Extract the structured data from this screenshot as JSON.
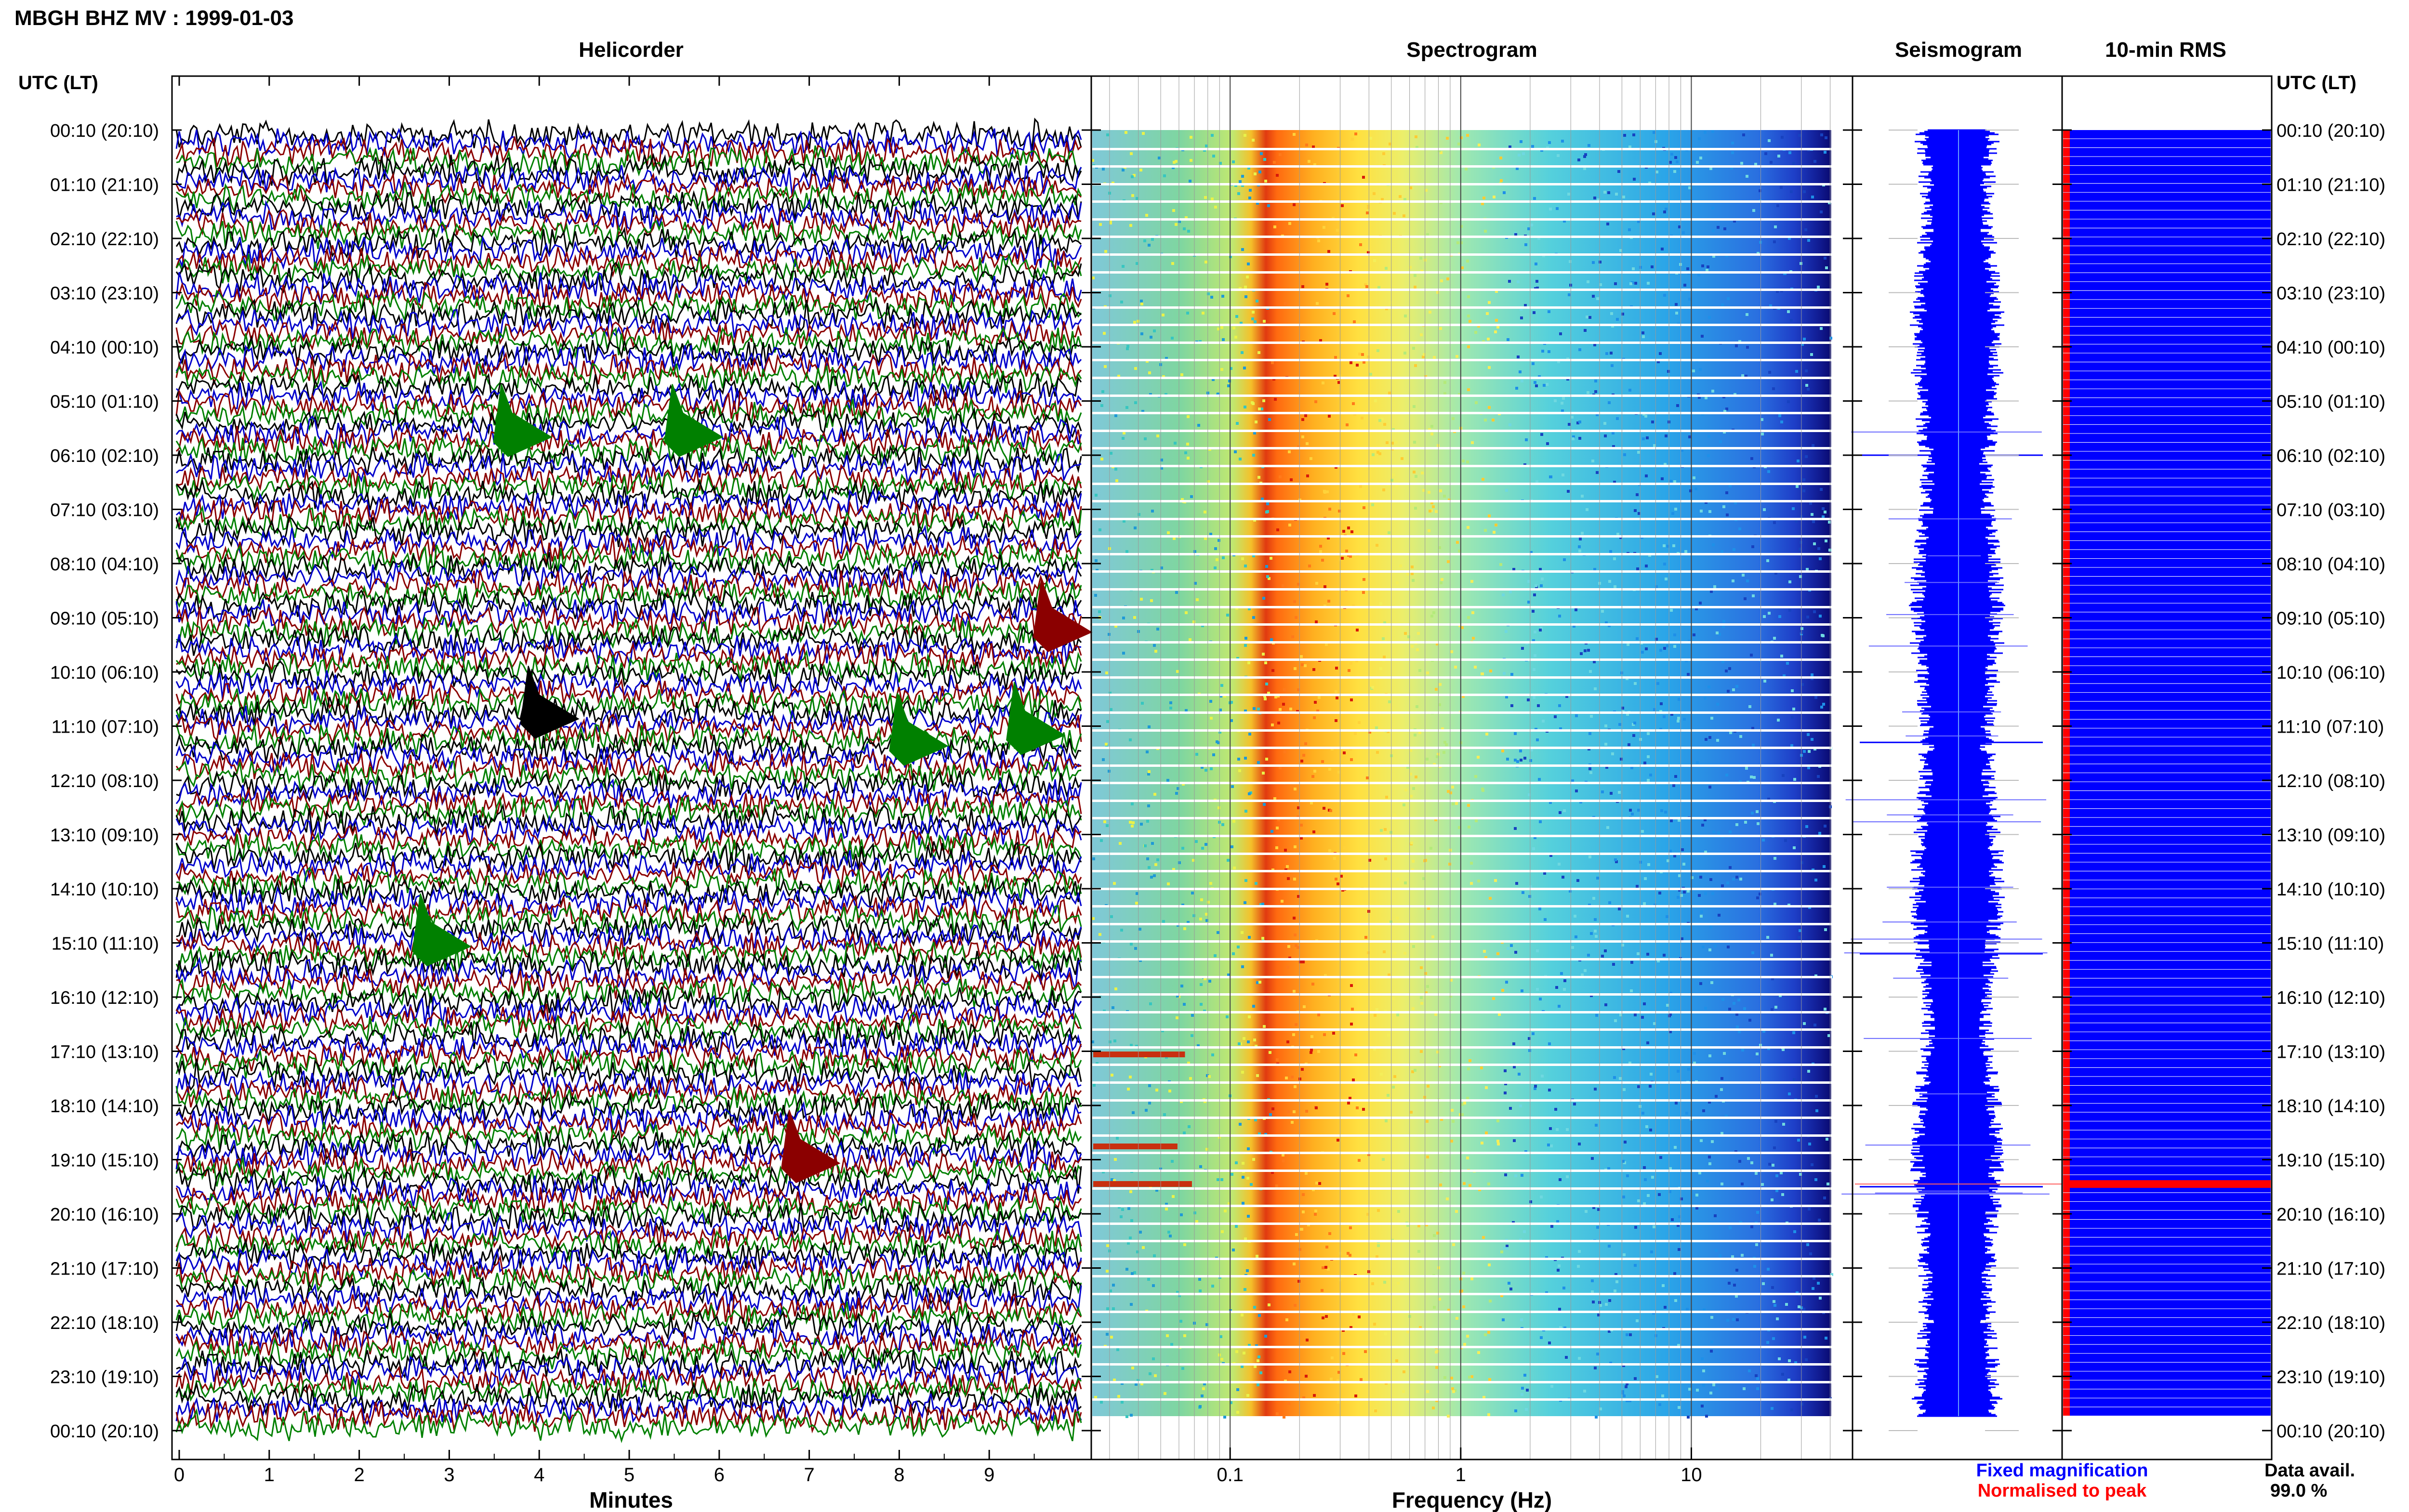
{
  "title": "MBGH BHZ MV : 1999-01-03",
  "panels": {
    "helicorder": "Helicorder",
    "spectrogram": "Spectrogram",
    "seismogram": "Seismogram",
    "rms": "10-min RMS"
  },
  "time_axis_label": "UTC (LT)",
  "hour_labels": [
    "00:10 (20:10)",
    "01:10 (21:10)",
    "02:10 (22:10)",
    "03:10 (23:10)",
    "04:10 (00:10)",
    "05:10 (01:10)",
    "06:10 (02:10)",
    "07:10 (03:10)",
    "08:10 (04:10)",
    "09:10 (05:10)",
    "10:10 (06:10)",
    "11:10 (07:10)",
    "12:10 (08:10)",
    "13:10 (09:10)",
    "14:10 (10:10)",
    "15:10 (11:10)",
    "16:10 (12:10)",
    "17:10 (13:10)",
    "18:10 (14:10)",
    "19:10 (15:10)",
    "20:10 (16:10)",
    "21:10 (17:10)",
    "22:10 (18:10)",
    "23:10 (19:10)",
    "00:10 (20:10)"
  ],
  "x_axes": {
    "helicorder": {
      "label": "Minutes",
      "ticks": [
        "0",
        "1",
        "2",
        "3",
        "4",
        "5",
        "6",
        "7",
        "8",
        "9"
      ],
      "range": [
        0,
        10
      ]
    },
    "spectrogram": {
      "label": "Frequency (Hz)",
      "ticks": [
        "0.1",
        "1",
        "10"
      ],
      "scale": "log",
      "range": [
        0.025,
        50
      ]
    }
  },
  "legend": {
    "fixed": "Fixed magnification",
    "normalised": "Normalised to peak",
    "data_avail_label": "Data avail.",
    "data_avail_value": "99.0 %"
  },
  "colors": {
    "trace_cycle": [
      "#000000",
      "#0000cc",
      "#8b0000",
      "#008000"
    ],
    "seismogram": "#0000ff",
    "rms_fixed": "#0000ff",
    "rms_peak": "#ff0000"
  },
  "chart_data": [
    {
      "type": "helicorder",
      "title": "Helicorder",
      "xlabel": "Minutes",
      "ylabel": "UTC (LT)",
      "xlim": [
        0,
        10
      ],
      "rows": 144,
      "events": [
        {
          "hour": 5.4,
          "minute": 3.6,
          "color": "#008000"
        },
        {
          "hour": 5.4,
          "minute": 5.5,
          "color": "#008000"
        },
        {
          "hour": 9.0,
          "minute": 9.6,
          "color": "#8b0000"
        },
        {
          "hour": 10.6,
          "minute": 3.9,
          "color": "#000000"
        },
        {
          "hour": 10.9,
          "minute": 9.3,
          "color": "#008000"
        },
        {
          "hour": 11.1,
          "minute": 8.0,
          "color": "#008000"
        },
        {
          "hour": 14.8,
          "minute": 2.7,
          "color": "#008000"
        },
        {
          "hour": 18.8,
          "minute": 6.8,
          "color": "#8b0000"
        }
      ]
    },
    {
      "type": "heatmap",
      "title": "Spectrogram",
      "xlabel": "Frequency (Hz)",
      "x_scale": "log",
      "xlim": [
        0.025,
        50
      ],
      "peak_band_hz": [
        0.17,
        0.35
      ]
    },
    {
      "type": "line",
      "title": "Seismogram",
      "notable_spikes_hour": [
        6.0,
        11.3,
        15.2,
        19.5
      ]
    },
    {
      "type": "bar",
      "title": "10-min RMS",
      "peak_hour": 19.45,
      "series": [
        {
          "name": "Fixed magnification",
          "color": "#0000ff"
        },
        {
          "name": "Normalised to peak",
          "color": "#ff0000"
        }
      ]
    }
  ]
}
